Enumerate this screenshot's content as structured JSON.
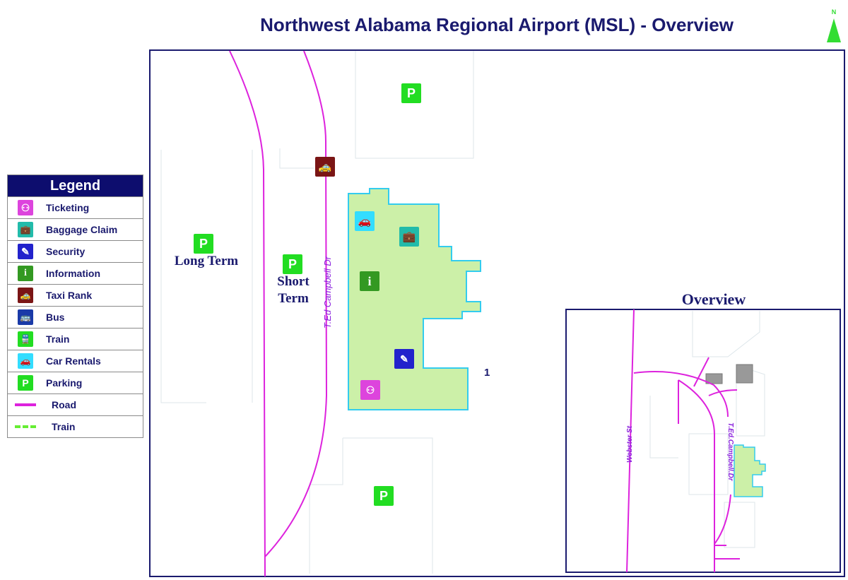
{
  "title": "Northwest Alabama Regional Airport (MSL) - Overview",
  "north_label": "N",
  "legend": {
    "heading": "Legend",
    "items": [
      {
        "label": "Ticketing",
        "icon": "ticketing-icon",
        "color": "#dd44dd"
      },
      {
        "label": "Baggage Claim",
        "icon": "baggage-icon",
        "color": "#22bbaa"
      },
      {
        "label": "Security",
        "icon": "security-icon",
        "color": "#2222cc"
      },
      {
        "label": "Information",
        "icon": "information-icon",
        "color": "#339922"
      },
      {
        "label": "Taxi Rank",
        "icon": "taxi-icon",
        "color": "#7a1515"
      },
      {
        "label": "Bus",
        "icon": "bus-icon",
        "color": "#1a3aa8"
      },
      {
        "label": "Train",
        "icon": "train-icon",
        "color": "#22dd22"
      },
      {
        "label": "Car Rentals",
        "icon": "car-rental-icon",
        "color": "#33ddff"
      },
      {
        "label": "Parking",
        "icon": "parking-icon",
        "color": "#22dd22"
      },
      {
        "label": "Road",
        "icon": "road-line",
        "color": "#dd22dd"
      },
      {
        "label": "Train",
        "icon": "train-line",
        "color": "#66ee33"
      }
    ]
  },
  "map": {
    "road_label": "T.Ed Campbell Dr",
    "long_term": "Long Term",
    "short_term": "Short Term",
    "gate_number": "1",
    "parking_glyph": "P",
    "terminal_color": "#ccf0a8"
  },
  "overview": {
    "title": "Overview",
    "road1": "Webster St",
    "road2": "T.Ed.Campbell.Dr"
  }
}
